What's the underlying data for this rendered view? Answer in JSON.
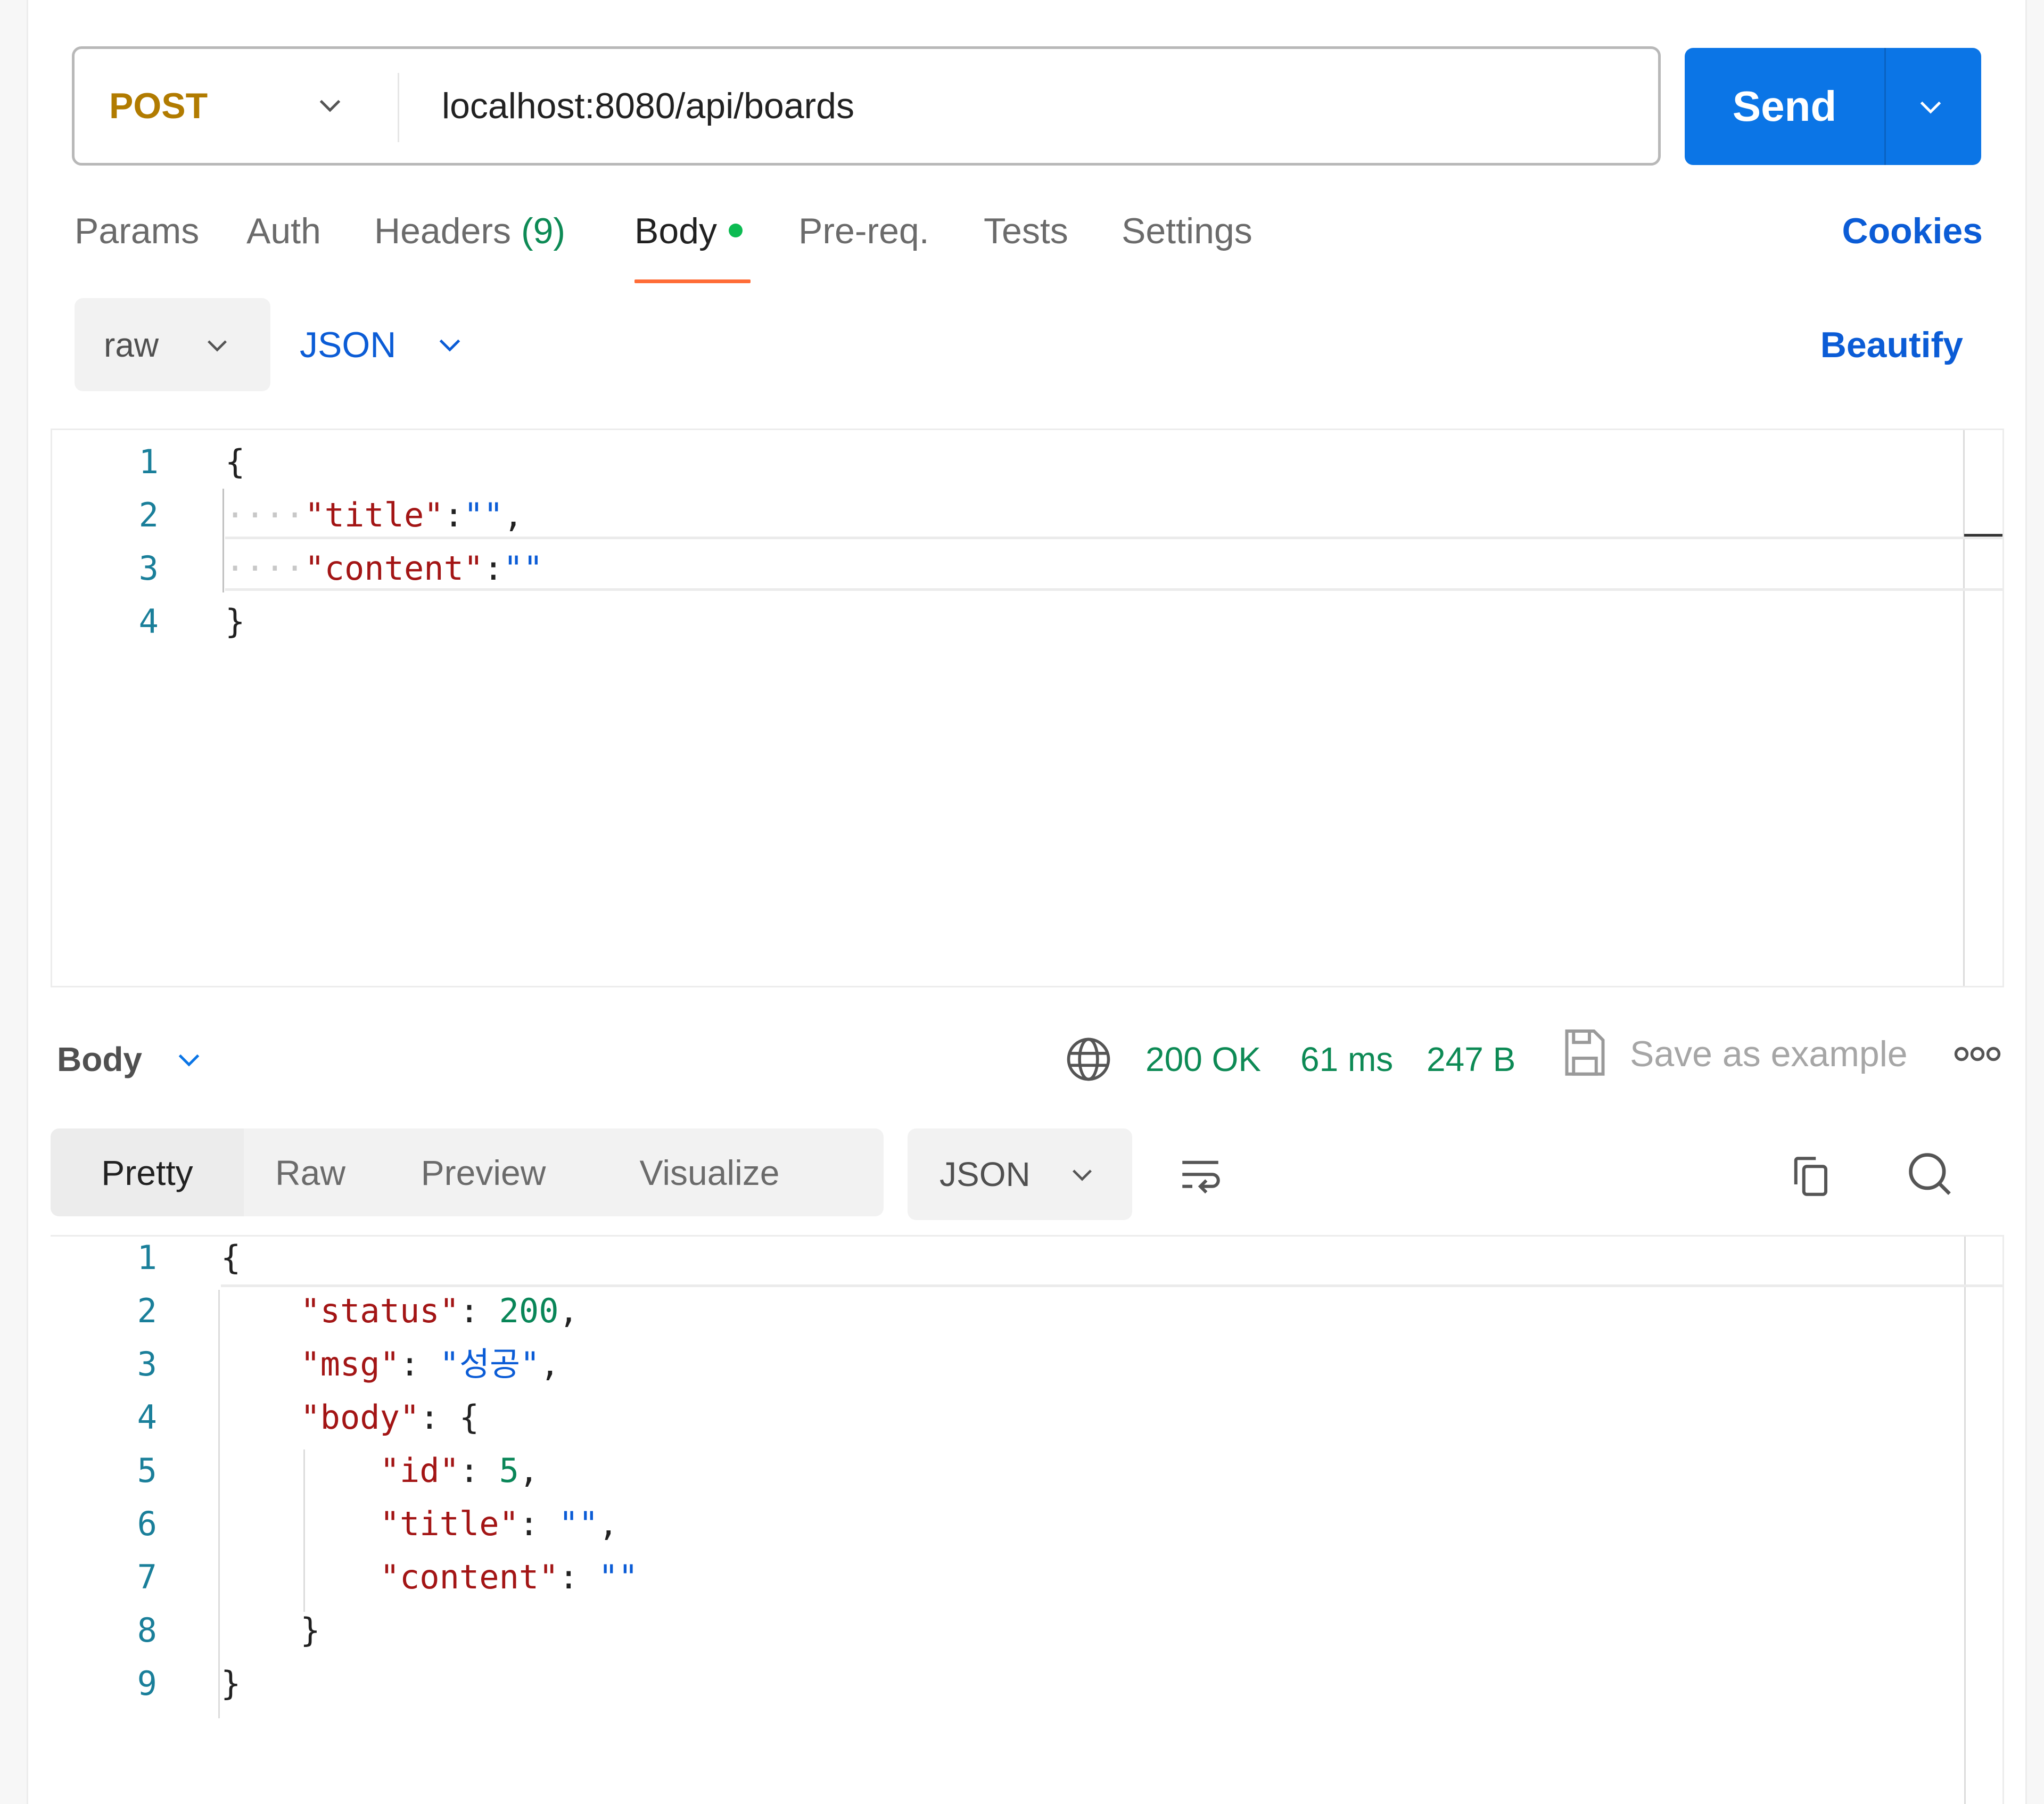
{
  "request": {
    "method": "POST",
    "url": "localhost:8080/api/boards",
    "send_label": "Send"
  },
  "tabs": [
    {
      "label": "Params"
    },
    {
      "label": "Auth"
    },
    {
      "label": "Headers",
      "count": "(9)"
    },
    {
      "label": "Body",
      "active": true,
      "indicator": "green-dot"
    },
    {
      "label": "Pre-req."
    },
    {
      "label": "Tests"
    },
    {
      "label": "Settings"
    }
  ],
  "cookies_label": "Cookies",
  "body_options": {
    "mode": "raw",
    "language": "JSON",
    "beautify_label": "Beautify"
  },
  "request_body": {
    "line_numbers": [
      "1",
      "2",
      "3",
      "4"
    ],
    "lines": [
      "{",
      "    \"title\":\"\",",
      "    \"content\":\"\"",
      "}"
    ]
  },
  "response": {
    "section_label": "Body",
    "status": "200 OK",
    "time": "61 ms",
    "size": "247 B",
    "save_example_label": "Save as example",
    "view_tabs": [
      "Pretty",
      "Raw",
      "Preview",
      "Visualize"
    ],
    "active_view": "Pretty",
    "format": "JSON",
    "line_numbers": [
      "1",
      "2",
      "3",
      "4",
      "5",
      "6",
      "7",
      "8",
      "9"
    ],
    "lines": [
      "{",
      "    \"status\": 200,",
      "    \"msg\": \"성공\",",
      "    \"body\": {",
      "        \"id\": 5,",
      "        \"title\": \"\",",
      "        \"content\": \"\"",
      "    }",
      "}"
    ],
    "json": {
      "status": 200,
      "msg": "성공",
      "body": {
        "id": 5,
        "title": "",
        "content": ""
      }
    }
  },
  "colors": {
    "method_post": "#b17b00",
    "send_button": "#0b75e6",
    "link_blue": "#0b5cd6",
    "active_tab_underline": "#ff6c37",
    "status_green": "#0d8a55",
    "json_key": "#a31515",
    "json_number": "#098658",
    "json_string": "#0b5cd6"
  }
}
